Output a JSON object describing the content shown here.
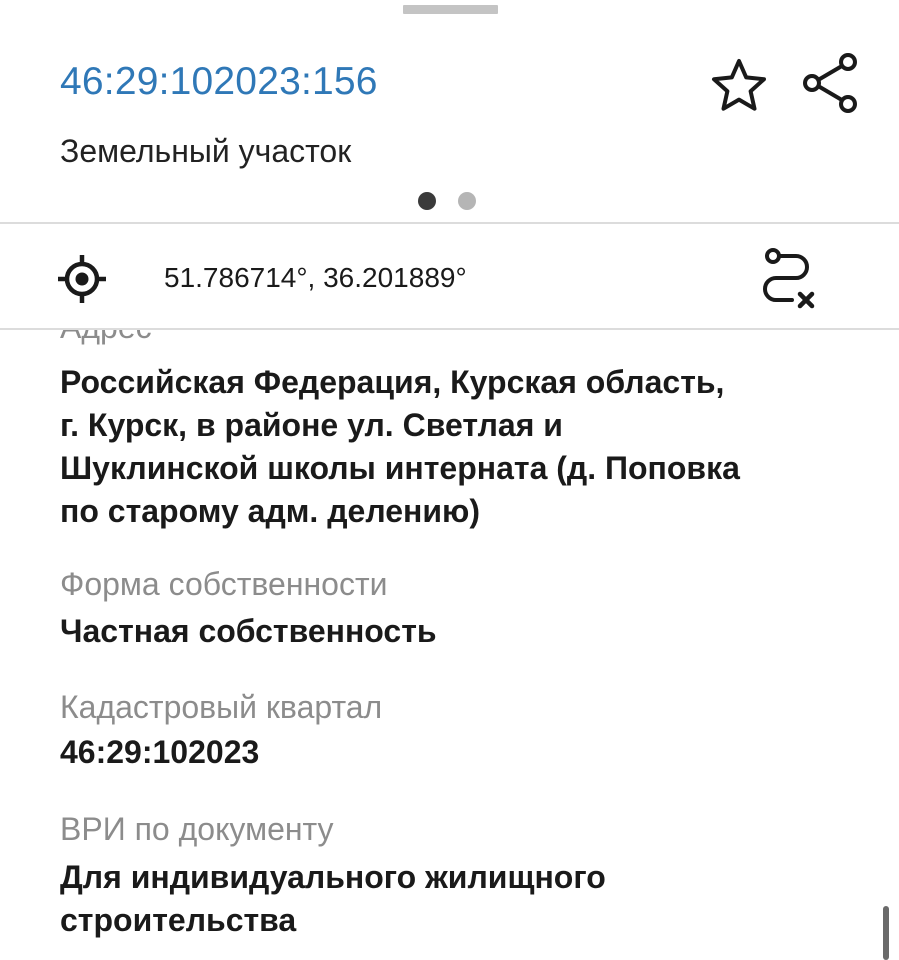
{
  "header": {
    "cadastral_number": "46:29:102023:156",
    "object_type": "Земельный участок"
  },
  "icons": {
    "favorite": "star-icon",
    "share": "share-icon",
    "locate": "target-icon",
    "route": "route-cancel-icon"
  },
  "pager": {
    "count": 2,
    "active_index": 0
  },
  "location": {
    "coordinates": "51.786714°, 36.201889°"
  },
  "fields": {
    "address": {
      "label": "Адрес",
      "value_lines": [
        "Российская Федерация, Курская область,",
        "г. Курск, в районе ул. Светлая и",
        "Шуклинской школы интерната (д. Поповка",
        "по старому адм. делению)"
      ]
    },
    "ownership": {
      "label": "Форма собственности",
      "value": "Частная собственность"
    },
    "quarter": {
      "label": "Кадастровый квартал",
      "value": "46:29:102023"
    },
    "permitted_use": {
      "label": "ВРИ по документу",
      "value_lines": [
        "Для индивидуального жилищного",
        "строительства"
      ]
    }
  },
  "colors": {
    "accent": "#2f78b7",
    "label": "#8c8c8c",
    "text": "#1a1a1a"
  }
}
